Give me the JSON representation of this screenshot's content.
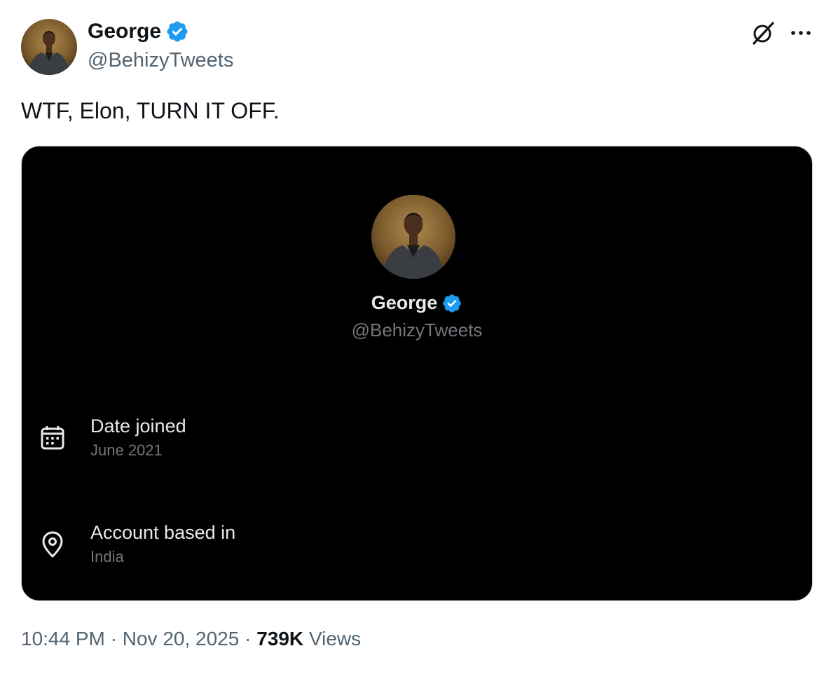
{
  "author": {
    "name": "George",
    "handle": "@BehizyTweets"
  },
  "tweet": {
    "text": "WTF, Elon, TURN IT OFF."
  },
  "embedded_card": {
    "name": "George",
    "handle": "@BehizyTweets",
    "items": [
      {
        "icon": "calendar-icon",
        "label": "Date joined",
        "value": "June 2021"
      },
      {
        "icon": "location-pin-icon",
        "label": "Account based in",
        "value": "India"
      }
    ]
  },
  "meta": {
    "time": "10:44 PM",
    "separator": " · ",
    "date": "Nov 20, 2025",
    "views_count": "739K",
    "views_label": "Views"
  },
  "colors": {
    "verified_blue": "#1d9bf0",
    "text_primary": "#0f1419",
    "text_secondary": "#536471",
    "card_bg": "#000000"
  }
}
